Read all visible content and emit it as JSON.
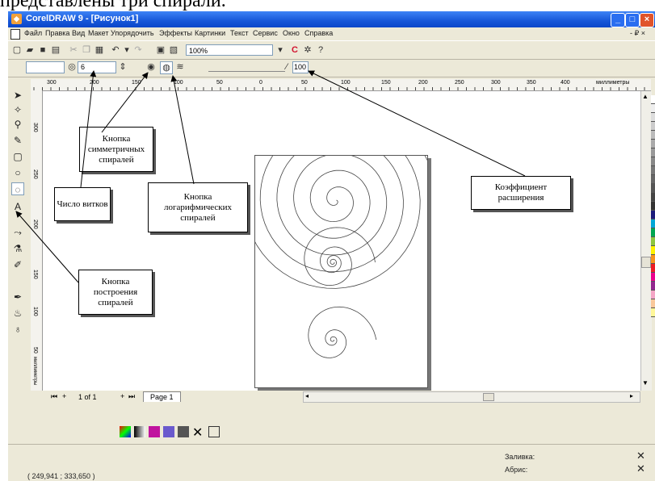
{
  "caption": "представлены три спирали.",
  "window": {
    "title": "CorelDRAW 9 - [Рисунок1]",
    "controls": [
      "_",
      "□",
      "×"
    ]
  },
  "menu": [
    "Файл",
    "Правка",
    "Вид",
    "Макет",
    "Упорядочить",
    "Эффекты",
    "Картинки",
    "Текст",
    "Сервис",
    "Окно",
    "Справка"
  ],
  "menu_right": "- ₽ ×",
  "toolbar": {
    "zoom": "100%"
  },
  "property_bar": {
    "revolutions": "6",
    "expansion": "100"
  },
  "ruler": {
    "ticks": [
      "300",
      "200",
      "150",
      "100",
      "50",
      "0",
      "50",
      "100",
      "150",
      "200",
      "250",
      "300",
      "350",
      "400"
    ],
    "units": "миллиметры",
    "vticks": [
      "300",
      "250",
      "200",
      "150",
      "100",
      "50"
    ],
    "vunits": "миллиметры"
  },
  "pagebar": {
    "counter": "1 of 1",
    "tab": "Page 1"
  },
  "status": {
    "coords": "( 249,941 ; 333,650 )",
    "fill_label": "Заливка:",
    "outline_label": "Абрис:"
  },
  "callouts": {
    "symmetric": "Кнопка симметричных спиралей",
    "turns": "Число витков",
    "log": "Кнопка логарифмических спиралей",
    "coef": "Коэффициент расширения",
    "build": "Кнопка построения спиралей"
  },
  "colors": {
    "title_bar": "#1656d8",
    "window_bg": "#ece9d8",
    "palette": [
      "#ffffff",
      "#eeeeee",
      "#dddddd",
      "#cccccc",
      "#bbbbbb",
      "#aaaaaa",
      "#999999",
      "#888888",
      "#777777",
      "#666666",
      "#555555",
      "#444444",
      "#333333",
      "#1b1b7a",
      "#00a6d6",
      "#00a651",
      "#8dc63f",
      "#fff200",
      "#f7941d",
      "#ed1c24",
      "#ec008c",
      "#92278f",
      "#f4a6c6",
      "#f9c89b",
      "#fff799"
    ]
  }
}
